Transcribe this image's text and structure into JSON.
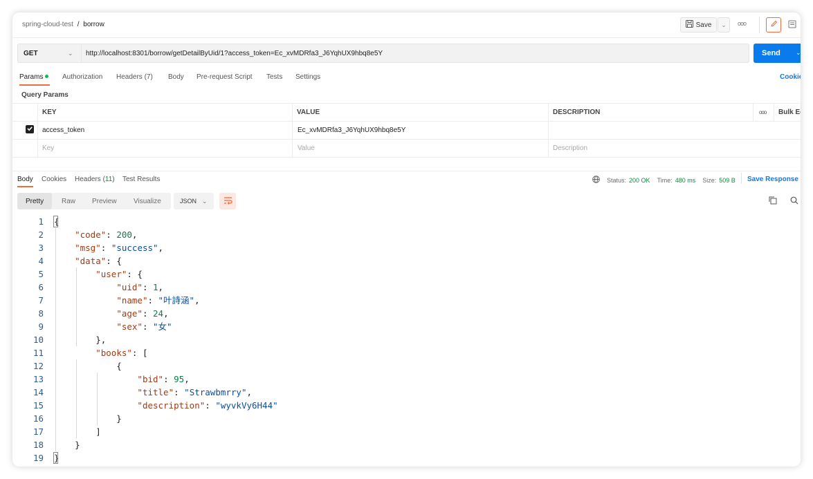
{
  "breadcrumb": {
    "collection": "spring-cloud-test",
    "separator": "/",
    "request": "borrow"
  },
  "header": {
    "save_label": "Save"
  },
  "request": {
    "method": "GET",
    "url": "http://localhost:8301/borrow/getDetailByUid/1?access_token=Ec_xvMDRfa3_J6YqhUX9hbq8e5Y",
    "send_label": "Send"
  },
  "request_tabs": [
    {
      "label": "Params"
    },
    {
      "label": "Authorization"
    },
    {
      "label": "Headers (7)"
    },
    {
      "label": "Body"
    },
    {
      "label": "Pre-request Script"
    },
    {
      "label": "Tests"
    },
    {
      "label": "Settings"
    }
  ],
  "cookies_label": "Cookie",
  "query_params": {
    "title": "Query Params",
    "headers": {
      "key": "KEY",
      "value": "VALUE",
      "description": "DESCRIPTION",
      "bulk": "Bulk Ec"
    },
    "rows": [
      {
        "checked": true,
        "key": "access_token",
        "value": "Ec_xvMDRfa3_J6YqhUX9hbq8e5Y",
        "description": ""
      }
    ],
    "placeholders": {
      "key": "Key",
      "value": "Value",
      "description": "Description"
    }
  },
  "response_tabs": {
    "body": "Body",
    "cookies": "Cookies",
    "headers_prefix": "Headers (",
    "headers_count": "11",
    "headers_suffix": ")",
    "test_results": "Test Results"
  },
  "response_meta": {
    "status_label": "Status:",
    "status_value": "200 OK",
    "time_label": "Time:",
    "time_value": "480 ms",
    "size_label": "Size:",
    "size_value": "509 B",
    "save_response": "Save Response"
  },
  "view_modes": [
    "Pretty",
    "Raw",
    "Preview",
    "Visualize"
  ],
  "format": "JSON",
  "code_lines": [
    {
      "n": "1",
      "segs": [
        [
          "p",
          "{"
        ]
      ]
    },
    {
      "n": "2",
      "segs": [
        [
          "p",
          "    "
        ],
        [
          "k",
          "\"code\""
        ],
        [
          "p",
          ": "
        ],
        [
          "n",
          "200"
        ],
        [
          "p",
          ","
        ]
      ]
    },
    {
      "n": "3",
      "segs": [
        [
          "p",
          "    "
        ],
        [
          "k",
          "\"msg\""
        ],
        [
          "p",
          ": "
        ],
        [
          "s",
          "\"success\""
        ],
        [
          "p",
          ","
        ]
      ]
    },
    {
      "n": "4",
      "segs": [
        [
          "p",
          "    "
        ],
        [
          "k",
          "\"data\""
        ],
        [
          "p",
          ": {"
        ]
      ]
    },
    {
      "n": "5",
      "segs": [
        [
          "p",
          "        "
        ],
        [
          "k",
          "\"user\""
        ],
        [
          "p",
          ": {"
        ]
      ]
    },
    {
      "n": "6",
      "segs": [
        [
          "p",
          "            "
        ],
        [
          "k",
          "\"uid\""
        ],
        [
          "p",
          ": "
        ],
        [
          "n",
          "1"
        ],
        [
          "p",
          ","
        ]
      ]
    },
    {
      "n": "7",
      "segs": [
        [
          "p",
          "            "
        ],
        [
          "k",
          "\"name\""
        ],
        [
          "p",
          ": "
        ],
        [
          "s",
          "\"叶詩涵\""
        ],
        [
          "p",
          ","
        ]
      ]
    },
    {
      "n": "8",
      "segs": [
        [
          "p",
          "            "
        ],
        [
          "k",
          "\"age\""
        ],
        [
          "p",
          ": "
        ],
        [
          "n",
          "24"
        ],
        [
          "p",
          ","
        ]
      ]
    },
    {
      "n": "9",
      "segs": [
        [
          "p",
          "            "
        ],
        [
          "k",
          "\"sex\""
        ],
        [
          "p",
          ": "
        ],
        [
          "s",
          "\"女\""
        ]
      ]
    },
    {
      "n": "10",
      "segs": [
        [
          "p",
          "        },"
        ]
      ]
    },
    {
      "n": "11",
      "segs": [
        [
          "p",
          "        "
        ],
        [
          "k",
          "\"books\""
        ],
        [
          "p",
          ": ["
        ]
      ]
    },
    {
      "n": "12",
      "segs": [
        [
          "p",
          "            {"
        ]
      ]
    },
    {
      "n": "13",
      "segs": [
        [
          "p",
          "                "
        ],
        [
          "k",
          "\"bid\""
        ],
        [
          "p",
          ": "
        ],
        [
          "n",
          "95"
        ],
        [
          "p",
          ","
        ]
      ]
    },
    {
      "n": "14",
      "segs": [
        [
          "p",
          "                "
        ],
        [
          "k",
          "\"title\""
        ],
        [
          "p",
          ": "
        ],
        [
          "s",
          "\"Strawbmrry\""
        ],
        [
          "p",
          ","
        ]
      ]
    },
    {
      "n": "15",
      "segs": [
        [
          "p",
          "                "
        ],
        [
          "k",
          "\"description\""
        ],
        [
          "p",
          ": "
        ],
        [
          "s",
          "\"wyvkVy6H44\""
        ]
      ]
    },
    {
      "n": "16",
      "segs": [
        [
          "p",
          "            }"
        ]
      ]
    },
    {
      "n": "17",
      "segs": [
        [
          "p",
          "        ]"
        ]
      ]
    },
    {
      "n": "18",
      "segs": [
        [
          "p",
          "    }"
        ]
      ]
    },
    {
      "n": "19",
      "segs": [
        [
          "p",
          "}"
        ]
      ]
    }
  ],
  "colors": {
    "accent": "#f26b3a",
    "send": "#097bed",
    "success": "#0cbb52"
  }
}
